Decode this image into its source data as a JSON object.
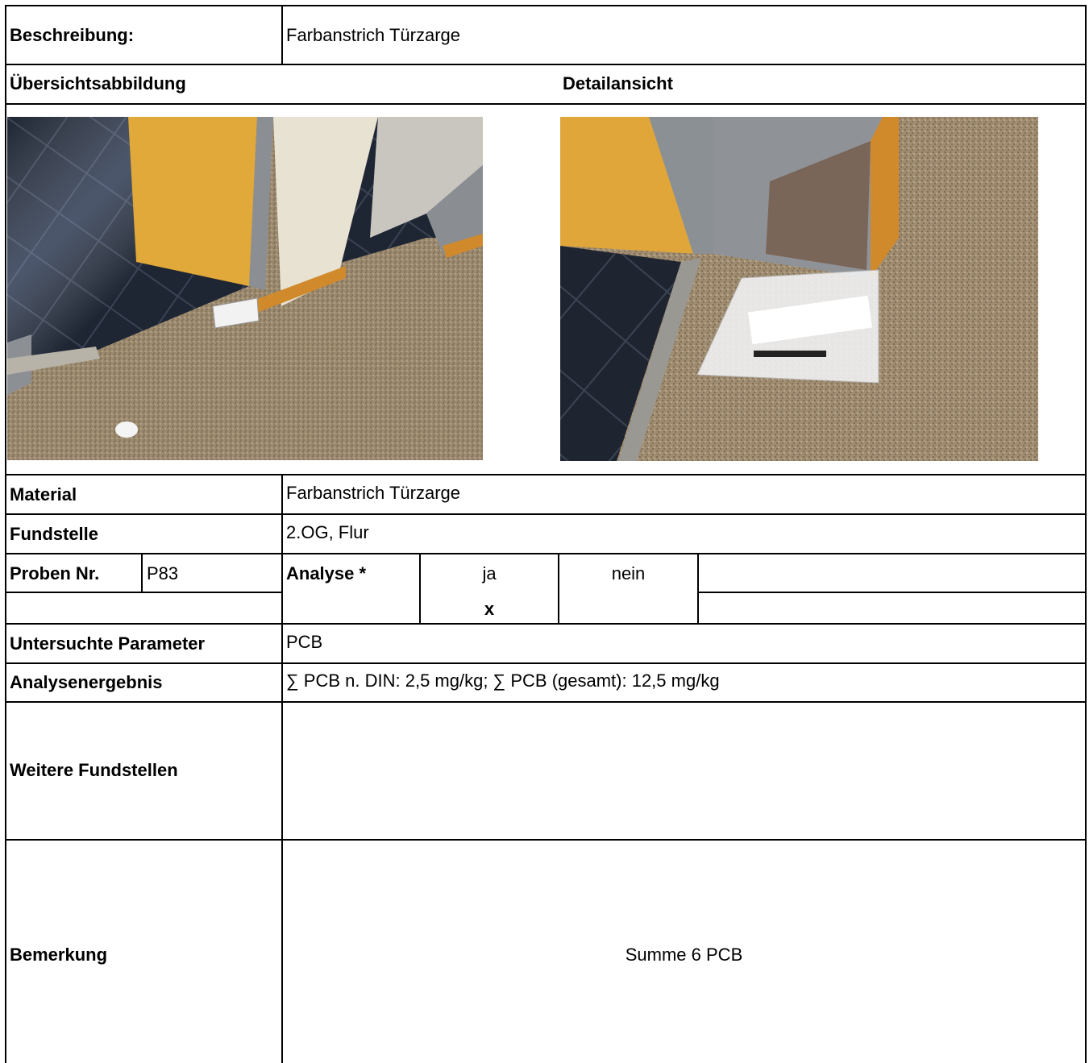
{
  "header": {
    "beschreibung_label": "Beschreibung:",
    "beschreibung_value": "Farbanstrich Türzarge"
  },
  "images": {
    "overview_label": "Übersichtsabbildung",
    "detail_label": "Detailansicht"
  },
  "fields": {
    "material_label": "Material",
    "material_value": "Farbanstrich Türzarge",
    "fundstelle_label": "Fundstelle",
    "fundstelle_value": "2.OG, Flur",
    "proben_label": "Proben Nr.",
    "proben_value": "P83",
    "analyse_label": "Analyse *",
    "ja_label": "ja",
    "nein_label": "nein",
    "ja_mark": "x",
    "parameter_label": "Untersuchte Parameter",
    "parameter_value": "PCB",
    "ergebnis_label": "Analysenergebnis",
    "ergebnis_value": "∑ PCB n. DIN: 2,5 mg/kg; ∑ PCB (gesamt): 12,5 mg/kg",
    "weitere_label": "Weitere Fundstellen",
    "weitere_value": "",
    "bemerkung_label": "Bemerkung",
    "bemerkung_value": "Summe 6 PCB"
  }
}
